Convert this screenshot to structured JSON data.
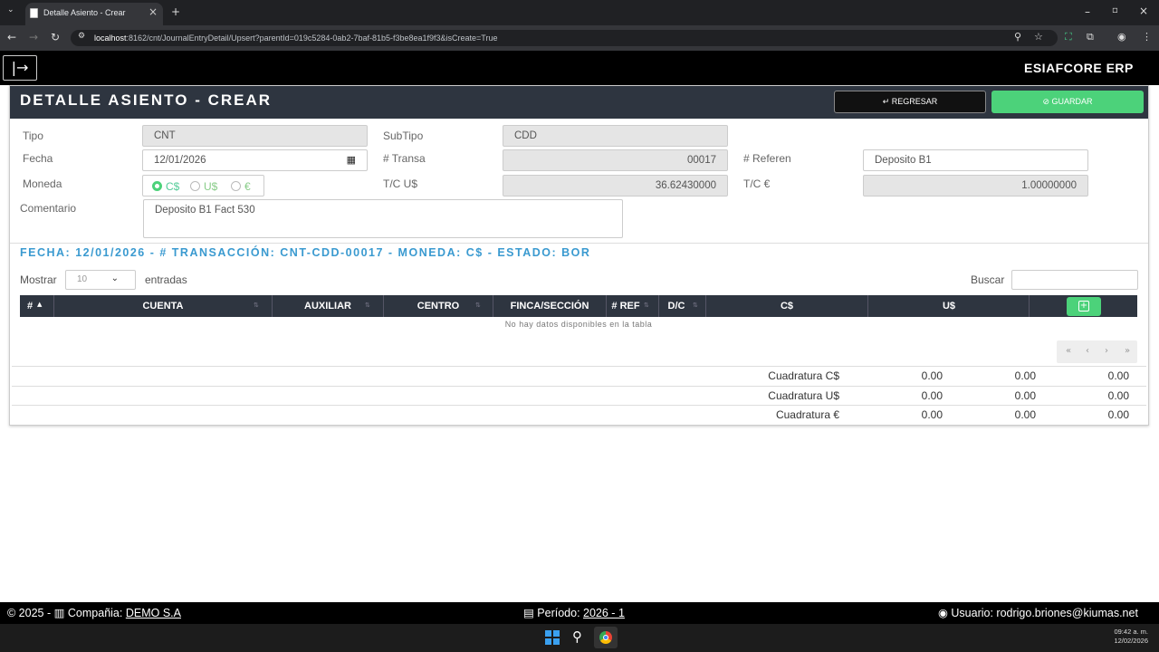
{
  "browser": {
    "tab_title": "Detalle Asiento - Crear",
    "url_host": "localhost",
    "url_rest": ":8162/cnt/JournalEntryDetail/Upsert?parentId=019c5284-0ab2-7baf-81b5-f3be8ea1f9f3&isCreate=True"
  },
  "app": {
    "brand": "ESIAFCORE ERP",
    "menu_icon": "sign-in-icon"
  },
  "page": {
    "title": "DETALLE ASIENTO - CREAR",
    "back_label": "↵ REGRESAR",
    "save_label": "⊘ GUARDAR"
  },
  "form": {
    "tipo_label": "Tipo",
    "tipo_value": "CNT",
    "subtipo_label": "SubTipo",
    "subtipo_value": "CDD",
    "fecha_label": "Fecha",
    "fecha_value": "12/01/2026",
    "transa_label": "# Transa",
    "transa_value": "00017",
    "referen_label": "# Referen",
    "referen_value": "Deposito B1",
    "moneda_label": "Moneda",
    "moneda_options": [
      "C$",
      "U$",
      "€"
    ],
    "moneda_selected": "C$",
    "tc_us_label": "T/C U$",
    "tc_us_value": "36.62430000",
    "tc_eur_label": "T/C €",
    "tc_eur_value": "1.00000000",
    "comentario_label": "Comentario",
    "comentario_value": "Deposito B1 Fact 530"
  },
  "summary": "FECHA: 12/01/2026 - # TRANSACCIÓN: CNT-CDD-00017 - MONEDA: C$ - ESTADO: BOR",
  "table": {
    "show_label": "Mostrar",
    "show_value": "10",
    "entries_label": "entradas",
    "search_label": "Buscar",
    "columns": [
      "#",
      "CUENTA",
      "AUXILIAR",
      "CENTRO",
      "FINCA/SECCIÓN",
      "# REF",
      "D/C",
      "C$",
      "U$"
    ],
    "empty_text": "No hay datos disponibles en la tabla",
    "pager": [
      "«",
      "‹",
      "›",
      "»"
    ]
  },
  "cuadratura": [
    {
      "label": "Cuadratura C$",
      "v1": "0.00",
      "v2": "0.00",
      "v3": "0.00"
    },
    {
      "label": "Cuadratura U$",
      "v1": "0.00",
      "v2": "0.00",
      "v3": "0.00"
    },
    {
      "label": "Cuadratura €",
      "v1": "0.00",
      "v2": "0.00",
      "v3": "0.00"
    }
  ],
  "footer": {
    "copyright": "© 2025 - ",
    "company_label": "Compañia: ",
    "company": "DEMO S.A",
    "period_label": "Período: ",
    "period": "2026 - 1",
    "user_label": "Usuario: ",
    "user": "rodrigo.briones@kiumas.net"
  },
  "clock": {
    "time": "09:42 a. m.",
    "date": "12/02/2026"
  }
}
